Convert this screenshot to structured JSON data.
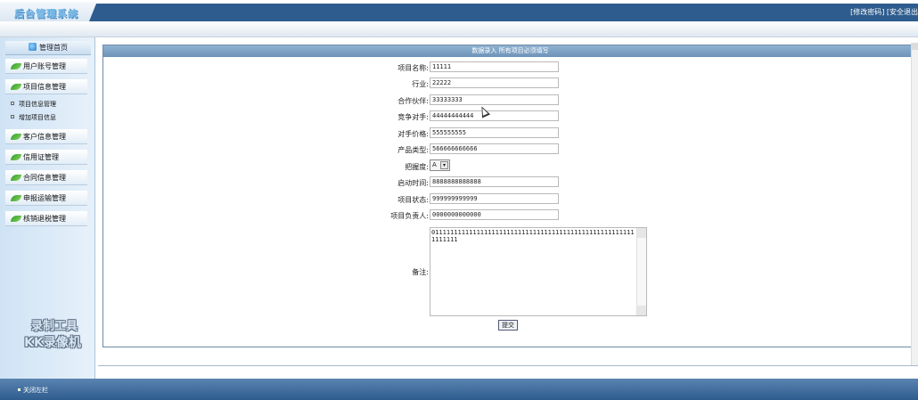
{
  "header": {
    "logo_text": "后台管理系统",
    "change_password": "[修改密码]",
    "logout": "[安全退出"
  },
  "sidebar": {
    "home": "管理首页",
    "menus": [
      "用户账号管理",
      "项目信息管理",
      "客户信息管理",
      "信用证管理",
      "合同信息管理",
      "申报运输管理",
      "核销退税管理"
    ],
    "submenus": [
      "项目信息管理",
      "增加项目信息"
    ]
  },
  "watermark": {
    "line1": "录制工具",
    "line2": "KK录像机"
  },
  "form": {
    "title": "数据录入  所有项目必须填写",
    "fields": [
      {
        "label": "项目名称:",
        "value": "11111"
      },
      {
        "label": "行业:",
        "value": "22222"
      },
      {
        "label": "合作伙伴:",
        "value": "33333333"
      },
      {
        "label": "竞争对手:",
        "value": "44444444444"
      },
      {
        "label": "对手价格:",
        "value": "555555555"
      },
      {
        "label": "产品类型:",
        "value": "566666666666"
      },
      {
        "label": "把握度:",
        "value": "A"
      },
      {
        "label": "启动时间:",
        "value": "8888888888888"
      },
      {
        "label": "项目状态:",
        "value": "999999999999"
      },
      {
        "label": "项目负责人:",
        "value": "0000000000000"
      }
    ],
    "remark_label": "备注:",
    "remark_value": "0111111111111111111111111111111111111111111111111111111111111",
    "submit_label": "提交"
  },
  "footer": {
    "close_sidebar": "关闭左栏"
  }
}
